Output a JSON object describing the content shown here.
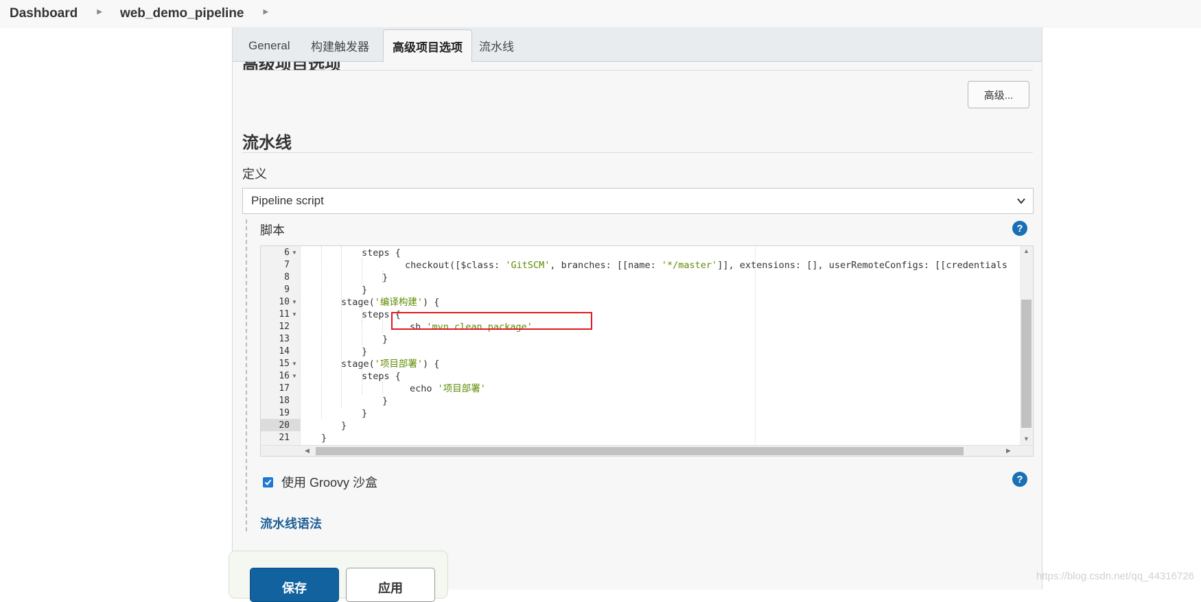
{
  "breadcrumb": {
    "items": [
      "Dashboard",
      "web_demo_pipeline"
    ]
  },
  "tabs": [
    {
      "label": "General"
    },
    {
      "label": "构建触发器"
    },
    {
      "label": "高级项目选项"
    },
    {
      "label": "流水线"
    }
  ],
  "active_tab": "高级项目选项",
  "advanced_section": {
    "title": "高级项目选项",
    "advanced_button": "高级..."
  },
  "pipeline": {
    "title": "流水线",
    "definition_label": "定义",
    "definition_value": "Pipeline script",
    "script_label": "脚本",
    "groovy_sandbox_label": "使用 Groovy 沙盒",
    "groovy_sandbox_checked": true,
    "syntax_link": "流水线语法"
  },
  "editor": {
    "active_line": 21,
    "line_numbers": [
      "6",
      "7",
      "8",
      "9",
      "10",
      "11",
      "12",
      "13",
      "14",
      "15",
      "16",
      "17",
      "18",
      "19",
      "20",
      "21"
    ],
    "foldable_lines": [
      "6",
      "10",
      "11",
      "15",
      "16"
    ],
    "lines": [
      {
        "code": "steps {",
        "string": ""
      },
      {
        "code": "checkout([$class: ",
        "string": "'GitSCM'",
        "rest": ", branches: [[name: ",
        "string2": "'*/master'",
        "rest2": "]], extensions: [], userRemoteConfigs: [[credentials"
      },
      {
        "code": "}",
        "string": ""
      },
      {
        "code": "}",
        "string": ""
      },
      {
        "code": "stage(",
        "string": "'编译构建'",
        "rest": ") {"
      },
      {
        "code": "steps {",
        "string": ""
      },
      {
        "code": "sh ",
        "string": "'mvn clean package'"
      },
      {
        "code": "}",
        "string": ""
      },
      {
        "code": "}",
        "string": ""
      },
      {
        "code": "stage(",
        "string": "'项目部署'",
        "rest": ") {"
      },
      {
        "code": "steps {",
        "string": ""
      },
      {
        "code": "echo ",
        "string": "'项目部署'"
      },
      {
        "code": "}",
        "string": ""
      },
      {
        "code": "}",
        "string": ""
      },
      {
        "code": "}",
        "string": ""
      },
      {
        "code": "}",
        "string": ""
      }
    ]
  },
  "buttons": {
    "save": "保存",
    "apply": "应用"
  },
  "watermark": "https://blog.csdn.net/qq_44316726",
  "colors": {
    "accent": "#11629f",
    "link": "#1e6096",
    "highlight": "#e0161d",
    "string": "#5e8a00"
  },
  "icons": {
    "help": "question-circle-icon",
    "select": "chevron-down-icon",
    "breadcrumb_separator": "caret-right-icon"
  }
}
